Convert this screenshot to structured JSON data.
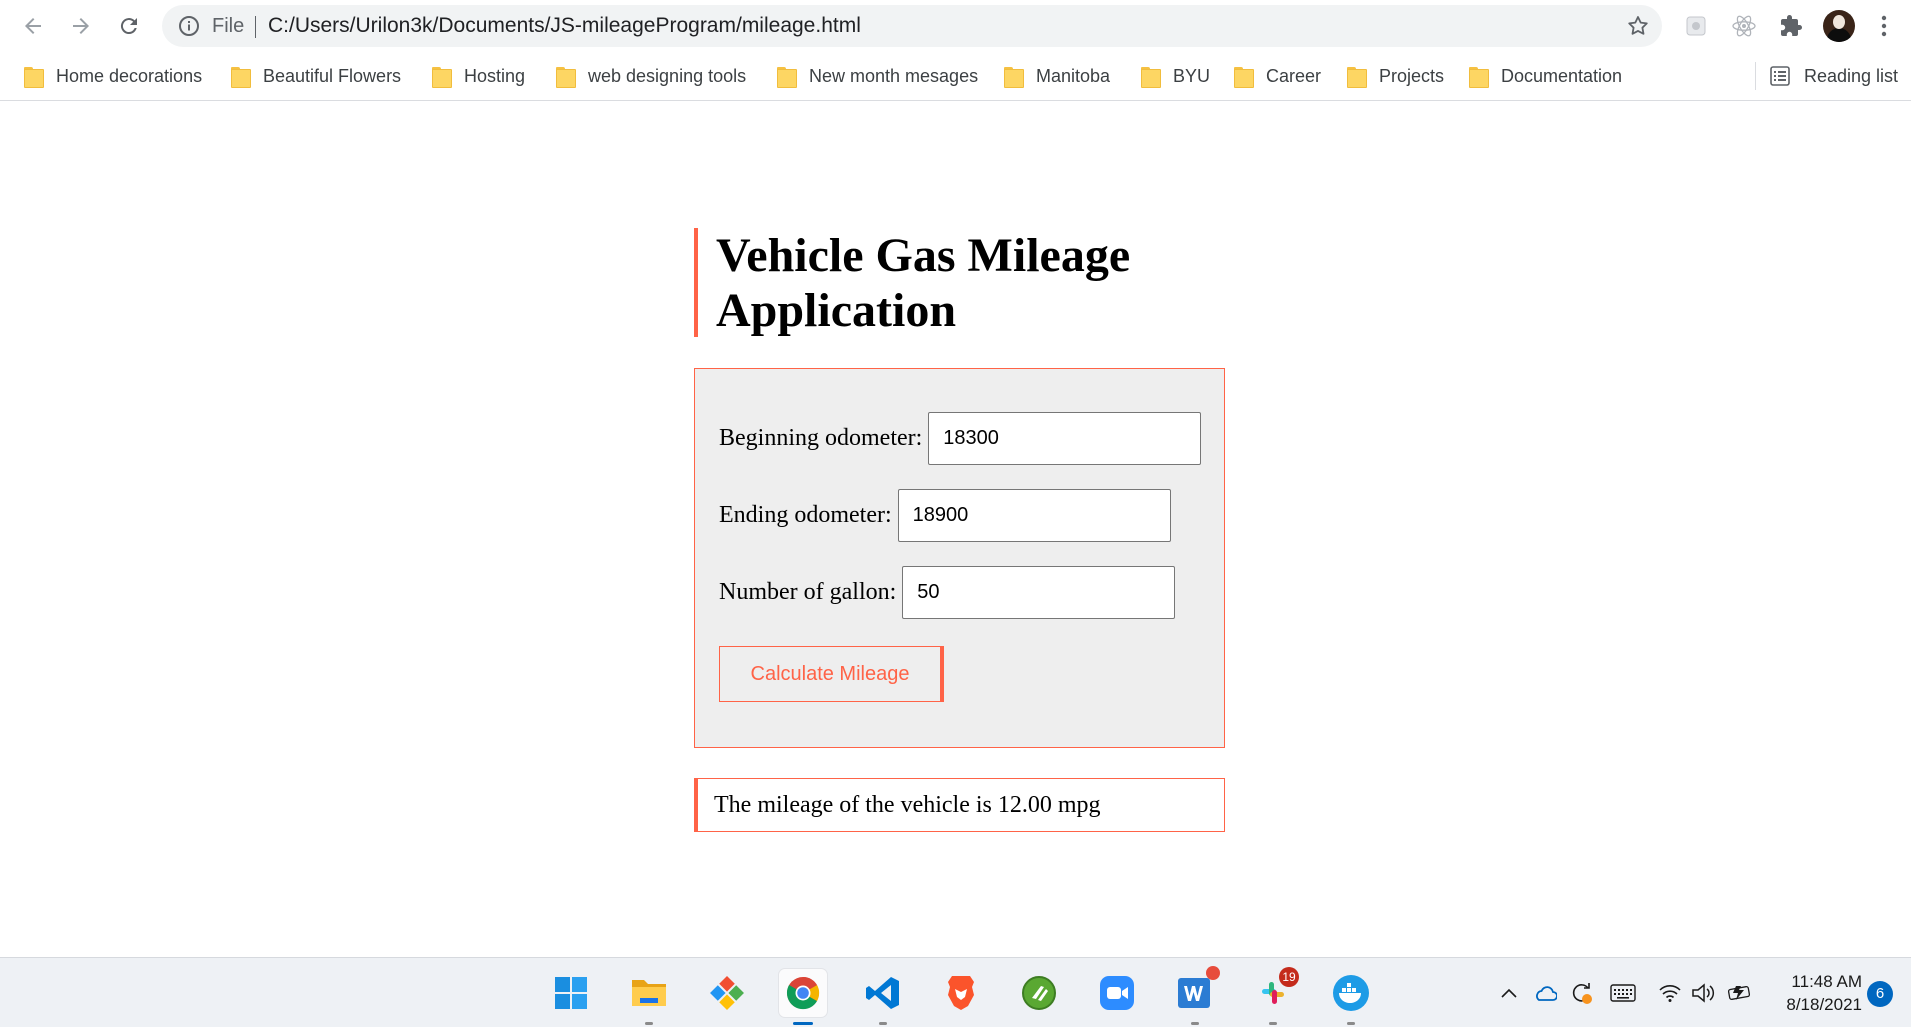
{
  "browser": {
    "omnibox": {
      "scheme_label": "File",
      "url": "C:/Users/Urilon3k/Documents/JS-mileageProgram/mileage.html"
    },
    "bookmarks": [
      {
        "label": "Home decorations"
      },
      {
        "label": "Beautiful Flowers"
      },
      {
        "label": "Hosting"
      },
      {
        "label": "web designing tools"
      },
      {
        "label": "New month mesages"
      },
      {
        "label": "Manitoba"
      },
      {
        "label": "BYU"
      },
      {
        "label": "Career"
      },
      {
        "label": "Projects"
      },
      {
        "label": "Documentation"
      }
    ],
    "reading_list_label": "Reading list",
    "icons": [
      "back-arrow-icon",
      "forward-arrow-icon",
      "reload-icon",
      "site-info-icon",
      "bookmark-star-icon",
      "extension-icon",
      "react-devtools-icon",
      "puzzle-extensions-icon",
      "profile-avatar",
      "more-menu-icon"
    ]
  },
  "page": {
    "title": "Vehicle Gas Mileage Application",
    "form": {
      "begin_label": "Beginning odometer:",
      "begin_value": "18300",
      "end_label": "Ending odometer:",
      "end_value": "18900",
      "gallons_label": "Number of gallon:",
      "gallons_value": "50",
      "button_label": "Calculate Mileage"
    },
    "result_text": "The mileage of the vehicle is 12.00 mpg",
    "accent_color": "#ff6347"
  },
  "taskbar": {
    "apps": [
      "windows-start-icon",
      "file-explorer-icon",
      "git-icon",
      "chrome-icon",
      "vscode-icon",
      "brave-icon",
      "app-icon",
      "zoom-icon",
      "word-icon",
      "slack-icon",
      "docker-icon"
    ],
    "slack_badge": "19",
    "clock_time": "11:48 AM",
    "clock_date": "8/18/2021",
    "notification_count": "6"
  }
}
